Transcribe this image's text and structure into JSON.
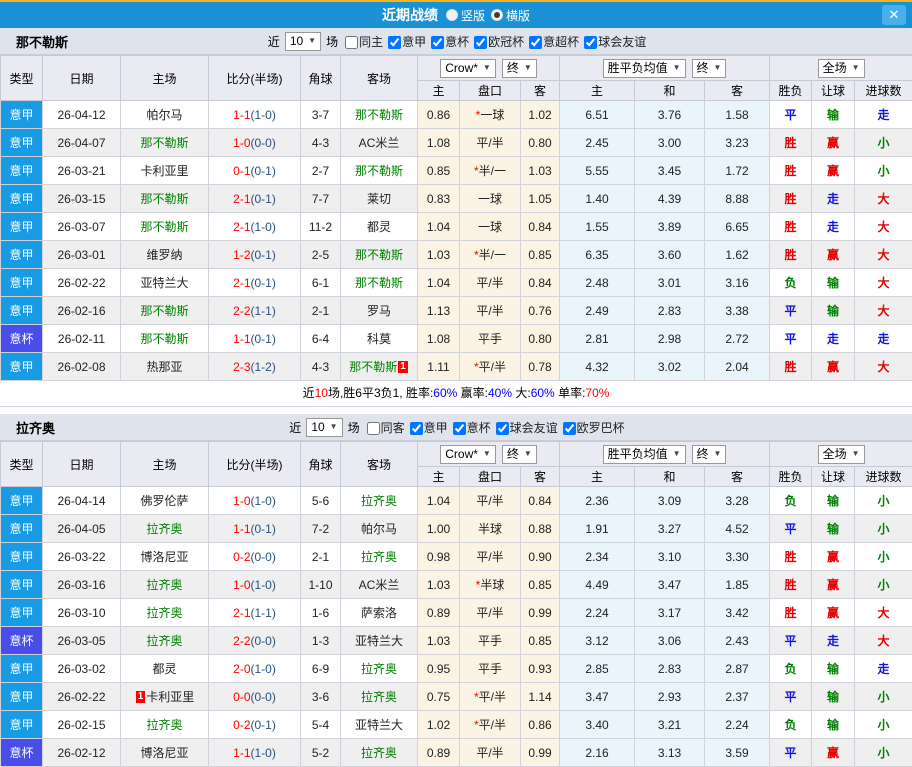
{
  "titlebar": {
    "title": "近期战绩",
    "vertical_label": "竖版",
    "horizontal_label": "横版",
    "selected_layout": "横版",
    "close_label": "✕"
  },
  "table_header": {
    "left_cols": [
      "类型",
      "日期",
      "主场",
      "比分(半场)",
      "角球",
      "客场"
    ],
    "odds_company_select": "Crow*",
    "odds_final_select": "终",
    "avg_select": "胜平负均值",
    "avg_final_select": "终",
    "scope_select": "全场",
    "sub_cols": [
      "主",
      "盘口",
      "客",
      "主",
      "和",
      "客",
      "胜负",
      "让球",
      "进球数"
    ]
  },
  "colors": {
    "league_blue": "#189be2",
    "cup_purple": "#4a4ee8",
    "team_green": "#008000",
    "score_red": "#ff0000",
    "half_navy": "#29517d",
    "star_red": "#ff0000",
    "badge_red": "#ff0000",
    "result_map": {
      "胜": "#e60000",
      "平": "#1414d8",
      "负": "#008000",
      "赢": "#e60000",
      "输": "#008000",
      "走": "#1414d8",
      "大": "#e60000",
      "小": "#008000"
    }
  },
  "sections": [
    {
      "team": "那不勒斯",
      "filter": {
        "near_label": "近",
        "count": "10",
        "games_label": "场",
        "same_label": "同主",
        "same_checked": false,
        "leagues": [
          {
            "label": "意甲",
            "checked": true
          },
          {
            "label": "意杯",
            "checked": true
          },
          {
            "label": "欧冠杯",
            "checked": true
          },
          {
            "label": "意超杯",
            "checked": true
          },
          {
            "label": "球会友谊",
            "checked": true
          }
        ]
      },
      "rows": [
        {
          "league": "意甲",
          "cup": false,
          "date": "26-04-12",
          "home": "帕尔马",
          "home_green": false,
          "score": "1-1",
          "half": "(1-0)",
          "corner": "3-7",
          "away": "那不勒斯",
          "away_green": true,
          "o1": "0.86",
          "hcp": "一球",
          "hcp_star": true,
          "o2": "1.02",
          "a1": "6.51",
          "a2": "3.76",
          "a3": "1.58",
          "r": [
            "平",
            "输",
            "走"
          ]
        },
        {
          "league": "意甲",
          "cup": false,
          "date": "26-04-07",
          "home": "那不勒斯",
          "home_green": true,
          "score": "1-0",
          "half": "(0-0)",
          "corner": "4-3",
          "away": "AC米兰",
          "away_green": false,
          "o1": "1.08",
          "hcp": "平/半",
          "hcp_star": false,
          "o2": "0.80",
          "a1": "2.45",
          "a2": "3.00",
          "a3": "3.23",
          "r": [
            "胜",
            "赢",
            "小"
          ]
        },
        {
          "league": "意甲",
          "cup": false,
          "date": "26-03-21",
          "home": "卡利亚里",
          "home_green": false,
          "score": "0-1",
          "half": "(0-1)",
          "corner": "2-7",
          "away": "那不勒斯",
          "away_green": true,
          "o1": "0.85",
          "hcp": "半/一",
          "hcp_star": true,
          "o2": "1.03",
          "a1": "5.55",
          "a2": "3.45",
          "a3": "1.72",
          "r": [
            "胜",
            "赢",
            "小"
          ]
        },
        {
          "league": "意甲",
          "cup": false,
          "date": "26-03-15",
          "home": "那不勒斯",
          "home_green": true,
          "score": "2-1",
          "half": "(0-1)",
          "corner": "7-7",
          "away": "莱切",
          "away_green": false,
          "o1": "0.83",
          "hcp": "一球",
          "hcp_star": false,
          "o2": "1.05",
          "a1": "1.40",
          "a2": "4.39",
          "a3": "8.88",
          "r": [
            "胜",
            "走",
            "大"
          ]
        },
        {
          "league": "意甲",
          "cup": false,
          "date": "26-03-07",
          "home": "那不勒斯",
          "home_green": true,
          "score": "2-1",
          "half": "(1-0)",
          "corner": "11-2",
          "away": "都灵",
          "away_green": false,
          "o1": "1.04",
          "hcp": "一球",
          "hcp_star": false,
          "o2": "0.84",
          "a1": "1.55",
          "a2": "3.89",
          "a3": "6.65",
          "r": [
            "胜",
            "走",
            "大"
          ]
        },
        {
          "league": "意甲",
          "cup": false,
          "date": "26-03-01",
          "home": "维罗纳",
          "home_green": false,
          "score": "1-2",
          "half": "(0-1)",
          "corner": "2-5",
          "away": "那不勒斯",
          "away_green": true,
          "o1": "1.03",
          "hcp": "半/一",
          "hcp_star": true,
          "o2": "0.85",
          "a1": "6.35",
          "a2": "3.60",
          "a3": "1.62",
          "r": [
            "胜",
            "赢",
            "大"
          ]
        },
        {
          "league": "意甲",
          "cup": false,
          "date": "26-02-22",
          "home": "亚特兰大",
          "home_green": false,
          "score": "2-1",
          "half": "(0-1)",
          "corner": "6-1",
          "away": "那不勒斯",
          "away_green": true,
          "o1": "1.04",
          "hcp": "平/半",
          "hcp_star": false,
          "o2": "0.84",
          "a1": "2.48",
          "a2": "3.01",
          "a3": "3.16",
          "r": [
            "负",
            "输",
            "大"
          ]
        },
        {
          "league": "意甲",
          "cup": false,
          "date": "26-02-16",
          "home": "那不勒斯",
          "home_green": true,
          "score": "2-2",
          "half": "(1-1)",
          "corner": "2-1",
          "away": "罗马",
          "away_green": false,
          "o1": "1.13",
          "hcp": "平/半",
          "hcp_star": false,
          "o2": "0.76",
          "a1": "2.49",
          "a2": "2.83",
          "a3": "3.38",
          "r": [
            "平",
            "输",
            "大"
          ]
        },
        {
          "league": "意杯",
          "cup": true,
          "date": "26-02-11",
          "home": "那不勒斯",
          "home_green": true,
          "score": "1-1",
          "half": "(0-1)",
          "corner": "6-4",
          "away": "科莫",
          "away_green": false,
          "o1": "1.08",
          "hcp": "平手",
          "hcp_star": false,
          "o2": "0.80",
          "a1": "2.81",
          "a2": "2.98",
          "a3": "2.72",
          "r": [
            "平",
            "走",
            "走"
          ]
        },
        {
          "league": "意甲",
          "cup": false,
          "date": "26-02-08",
          "home": "热那亚",
          "home_green": false,
          "score": "2-3",
          "half": "(1-2)",
          "corner": "4-3",
          "away": "那不勒斯",
          "away_green": true,
          "away_badge": "1",
          "o1": "1.11",
          "hcp": "平/半",
          "hcp_star": true,
          "o2": "0.78",
          "a1": "4.32",
          "a2": "3.02",
          "a3": "2.04",
          "r": [
            "胜",
            "赢",
            "大"
          ]
        }
      ],
      "summary": [
        {
          "t": "近",
          "c": "#000000"
        },
        {
          "t": "10",
          "c": "#ff0000"
        },
        {
          "t": "场,胜6平3负1, 胜率:",
          "c": "#000000"
        },
        {
          "t": "60%",
          "c": "#0000ff"
        },
        {
          "t": " 赢率:",
          "c": "#000000"
        },
        {
          "t": "40%",
          "c": "#0000ff"
        },
        {
          "t": " 大:",
          "c": "#000000"
        },
        {
          "t": "60%",
          "c": "#0000ff"
        },
        {
          "t": " 单率:",
          "c": "#000000"
        },
        {
          "t": "70%",
          "c": "#ff0000"
        }
      ]
    },
    {
      "team": "拉齐奥",
      "filter": {
        "near_label": "近",
        "count": "10",
        "games_label": "场",
        "same_label": "同客",
        "same_checked": false,
        "leagues": [
          {
            "label": "意甲",
            "checked": true
          },
          {
            "label": "意杯",
            "checked": true
          },
          {
            "label": "球会友谊",
            "checked": true
          },
          {
            "label": "欧罗巴杯",
            "checked": true
          }
        ]
      },
      "rows": [
        {
          "league": "意甲",
          "cup": false,
          "date": "26-04-14",
          "home": "佛罗伦萨",
          "home_green": false,
          "score": "1-0",
          "half": "(1-0)",
          "corner": "5-6",
          "away": "拉齐奥",
          "away_green": true,
          "o1": "1.04",
          "hcp": "平/半",
          "hcp_star": false,
          "o2": "0.84",
          "a1": "2.36",
          "a2": "3.09",
          "a3": "3.28",
          "r": [
            "负",
            "输",
            "小"
          ]
        },
        {
          "league": "意甲",
          "cup": false,
          "date": "26-04-05",
          "home": "拉齐奥",
          "home_green": true,
          "score": "1-1",
          "half": "(0-1)",
          "corner": "7-2",
          "away": "帕尔马",
          "away_green": false,
          "o1": "1.00",
          "hcp": "半球",
          "hcp_star": false,
          "o2": "0.88",
          "a1": "1.91",
          "a2": "3.27",
          "a3": "4.52",
          "r": [
            "平",
            "输",
            "小"
          ]
        },
        {
          "league": "意甲",
          "cup": false,
          "date": "26-03-22",
          "home": "博洛尼亚",
          "home_green": false,
          "score": "0-2",
          "half": "(0-0)",
          "corner": "2-1",
          "away": "拉齐奥",
          "away_green": true,
          "o1": "0.98",
          "hcp": "平/半",
          "hcp_star": false,
          "o2": "0.90",
          "a1": "2.34",
          "a2": "3.10",
          "a3": "3.30",
          "r": [
            "胜",
            "赢",
            "小"
          ]
        },
        {
          "league": "意甲",
          "cup": false,
          "date": "26-03-16",
          "home": "拉齐奥",
          "home_green": true,
          "score": "1-0",
          "half": "(1-0)",
          "corner": "1-10",
          "away": "AC米兰",
          "away_green": false,
          "o1": "1.03",
          "hcp": "半球",
          "hcp_star": true,
          "o2": "0.85",
          "a1": "4.49",
          "a2": "3.47",
          "a3": "1.85",
          "r": [
            "胜",
            "赢",
            "小"
          ]
        },
        {
          "league": "意甲",
          "cup": false,
          "date": "26-03-10",
          "home": "拉齐奥",
          "home_green": true,
          "score": "2-1",
          "half": "(1-1)",
          "corner": "1-6",
          "away": "萨索洛",
          "away_green": false,
          "o1": "0.89",
          "hcp": "平/半",
          "hcp_star": false,
          "o2": "0.99",
          "a1": "2.24",
          "a2": "3.17",
          "a3": "3.42",
          "r": [
            "胜",
            "赢",
            "大"
          ]
        },
        {
          "league": "意杯",
          "cup": true,
          "date": "26-03-05",
          "home": "拉齐奥",
          "home_green": true,
          "score": "2-2",
          "half": "(0-0)",
          "corner": "1-3",
          "away": "亚特兰大",
          "away_green": false,
          "o1": "1.03",
          "hcp": "平手",
          "hcp_star": false,
          "o2": "0.85",
          "a1": "3.12",
          "a2": "3.06",
          "a3": "2.43",
          "r": [
            "平",
            "走",
            "大"
          ]
        },
        {
          "league": "意甲",
          "cup": false,
          "date": "26-03-02",
          "home": "都灵",
          "home_green": false,
          "score": "2-0",
          "half": "(1-0)",
          "corner": "6-9",
          "away": "拉齐奥",
          "away_green": true,
          "o1": "0.95",
          "hcp": "平手",
          "hcp_star": false,
          "o2": "0.93",
          "a1": "2.85",
          "a2": "2.83",
          "a3": "2.87",
          "r": [
            "负",
            "输",
            "走"
          ]
        },
        {
          "league": "意甲",
          "cup": false,
          "date": "26-02-22",
          "home": "卡利亚里",
          "home_green": false,
          "home_badge": "1",
          "score": "0-0",
          "half": "(0-0)",
          "corner": "3-6",
          "away": "拉齐奥",
          "away_green": true,
          "o1": "0.75",
          "hcp": "平/半",
          "hcp_star": true,
          "o2": "1.14",
          "a1": "3.47",
          "a2": "2.93",
          "a3": "2.37",
          "r": [
            "平",
            "输",
            "小"
          ]
        },
        {
          "league": "意甲",
          "cup": false,
          "date": "26-02-15",
          "home": "拉齐奥",
          "home_green": true,
          "score": "0-2",
          "half": "(0-1)",
          "corner": "5-4",
          "away": "亚特兰大",
          "away_green": false,
          "o1": "1.02",
          "hcp": "平/半",
          "hcp_star": true,
          "o2": "0.86",
          "a1": "3.40",
          "a2": "3.21",
          "a3": "2.24",
          "r": [
            "负",
            "输",
            "小"
          ]
        },
        {
          "league": "意杯",
          "cup": true,
          "date": "26-02-12",
          "home": "博洛尼亚",
          "home_green": false,
          "score": "1-1",
          "half": "(1-0)",
          "corner": "5-2",
          "away": "拉齐奥",
          "away_green": true,
          "o1": "0.89",
          "hcp": "平/半",
          "hcp_star": false,
          "o2": "0.99",
          "a1": "2.16",
          "a2": "3.13",
          "a3": "3.59",
          "r": [
            "平",
            "赢",
            "小"
          ]
        }
      ]
    }
  ]
}
